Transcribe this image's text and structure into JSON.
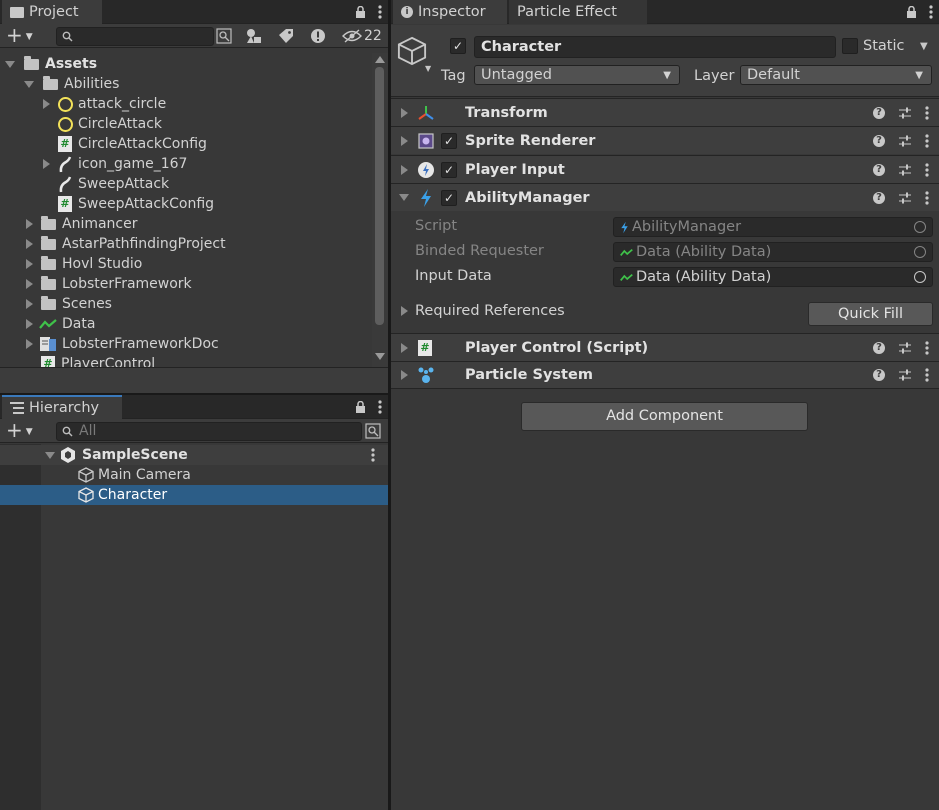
{
  "project": {
    "tab_label": "Project",
    "hidden_count": "22",
    "tree": [
      {
        "label": "Assets",
        "bold": true,
        "expanded": true
      },
      {
        "label": "Abilities",
        "expanded": true
      },
      {
        "label": "attack_circle"
      },
      {
        "label": "CircleAttack"
      },
      {
        "label": "CircleAttackConfig"
      },
      {
        "label": "icon_game_167"
      },
      {
        "label": "SweepAttack"
      },
      {
        "label": "SweepAttackConfig"
      },
      {
        "label": "Animancer"
      },
      {
        "label": "AstarPathfindingProject"
      },
      {
        "label": "Hovl Studio"
      },
      {
        "label": "LobsterFramework"
      },
      {
        "label": "Scenes"
      },
      {
        "label": "Data"
      },
      {
        "label": "LobsterFrameworkDoc"
      },
      {
        "label": "PlayerControl"
      }
    ]
  },
  "hierarchy": {
    "tab_label": "Hierarchy",
    "search_placeholder": "All",
    "scene": "SampleScene",
    "items": [
      {
        "label": "Main Camera"
      },
      {
        "label": "Character"
      }
    ]
  },
  "inspector": {
    "tabs": [
      {
        "label": "Inspector"
      },
      {
        "label": "Particle Effect"
      }
    ],
    "object_name": "Character",
    "static_label": "Static",
    "tag_label": "Tag",
    "tag_value": "Untagged",
    "layer_label": "Layer",
    "layer_value": "Default",
    "components": [
      {
        "name": "Transform"
      },
      {
        "name": "Sprite Renderer"
      },
      {
        "name": "Player Input"
      },
      {
        "name": "AbilityManager"
      },
      {
        "name": "Player Control (Script)"
      },
      {
        "name": "Particle System"
      }
    ],
    "ability_fields": [
      {
        "label": "Script",
        "value": "AbilityManager"
      },
      {
        "label": "Binded Requester",
        "value": "Data (Ability Data)"
      },
      {
        "label": "Input Data",
        "value": "Data (Ability Data)"
      }
    ],
    "required_refs_label": "Required References",
    "quick_fill_label": "Quick Fill",
    "add_component_label": "Add Component"
  },
  "colors": {
    "selection": "#2c5d87",
    "accent_green": "#3fc24a",
    "script_icon": "#4dbb5a",
    "ability_blue": "#3aa0e8"
  }
}
